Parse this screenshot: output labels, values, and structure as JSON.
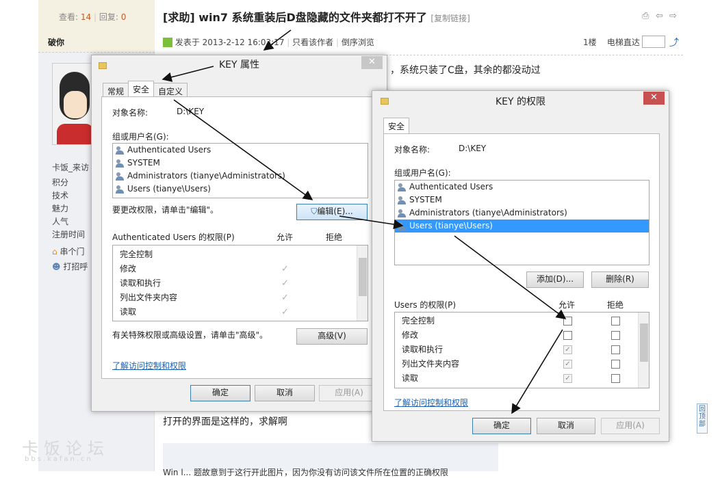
{
  "forum": {
    "views_label": "查看:",
    "views": "14",
    "replies_label": "回复:",
    "replies": "0",
    "author": "破你",
    "thread_title": "[求助] win7 系统重装后D盘隐藏的文件夹都打不开了",
    "copy_link": "[复制链接]",
    "post_time": "发表于 2013-2-12 16:03:17",
    "only_author": "只看该作者",
    "reverse": "倒序浏览",
    "floor": "1楼",
    "elevator": "电梯直达",
    "body_line1": "，系统只装了C盘，其余的都没动过",
    "body_line2": "打开的界面是这样的，求解啊",
    "quote_text": "Win l... 题故意到于这行开此图片，因为你没有访问该文件所在位置的正确权限",
    "user_fields": [
      "卡饭_来访",
      "积分",
      "技术",
      "魅力",
      "人气",
      "注册时间"
    ],
    "user_links": [
      "串个门",
      "打招呼"
    ],
    "watermark": "卡饭论坛",
    "watermark_url": "bbs.kafan.cn",
    "back_to_top": "回顶部"
  },
  "dlg1": {
    "title": "KEY 属性",
    "tabs": [
      "常规",
      "安全",
      "自定义"
    ],
    "object_label": "对象名称:",
    "object_value": "D:\\KEY",
    "group_label": "组或用户名(G):",
    "users": [
      "Authenticated Users",
      "SYSTEM",
      "Administrators (tianye\\Administrators)",
      "Users (tianye\\Users)"
    ],
    "change_hint": "要更改权限，请单击\"编辑\"。",
    "edit_button": "编辑(E)...",
    "perm_header": "Authenticated Users 的权限(P)",
    "allow": "允许",
    "deny": "拒绝",
    "perms": [
      "完全控制",
      "修改",
      "读取和执行",
      "列出文件夹内容",
      "读取"
    ],
    "perm_allow": [
      false,
      true,
      true,
      true,
      true
    ],
    "special_hint": "有关特殊权限或高级设置，请单击\"高级\"。",
    "advanced_button": "高级(V)",
    "learn_link": "了解访问控制和权限",
    "ok": "确定",
    "cancel": "取消",
    "apply": "应用(A)"
  },
  "dlg2": {
    "title": "KEY 的权限",
    "tab": "安全",
    "object_label": "对象名称:",
    "object_value": "D:\\KEY",
    "group_label": "组或用户名(G):",
    "users": [
      "Authenticated Users",
      "SYSTEM",
      "Administrators (tianye\\Administrators)",
      "Users (tianye\\Users)"
    ],
    "selected_user": "Users (tianye\\Users)",
    "add_button": "添加(D)...",
    "remove_button": "删除(R)",
    "perm_header": "Users 的权限(P)",
    "allow": "允许",
    "deny": "拒绝",
    "perms": [
      "完全控制",
      "修改",
      "读取和执行",
      "列出文件夹内容",
      "读取"
    ],
    "perm_allow": [
      false,
      false,
      true,
      true,
      true
    ],
    "learn_link": "了解访问控制和权限",
    "ok": "确定",
    "cancel": "取消",
    "apply": "应用(A)"
  },
  "colors": {
    "accent": "#3399ff",
    "close_red": "#c75050",
    "close_grey": "#c7c7c7",
    "link": "#1a5fb4",
    "stat_orange": "#c25b24"
  }
}
